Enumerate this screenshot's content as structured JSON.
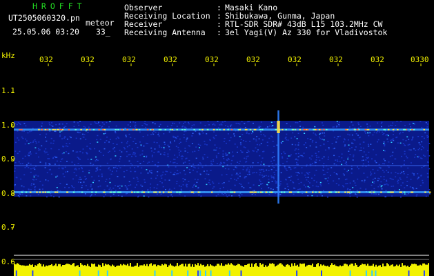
{
  "header": {
    "app_name": "HROFFT",
    "filename": "UT2505060320.pn",
    "meteor_label": "meteor",
    "datetime": "25.05.06 03:20",
    "count": "33_",
    "fields": [
      {
        "label": "Observer",
        "sep": ":",
        "value": "Masaki Kano"
      },
      {
        "label": "Receiving Location",
        "sep": ":",
        "value": "Shibukawa, Gunma, Japan"
      },
      {
        "label": "Receiver",
        "sep": ":",
        "value": "RTL-SDR SDR# 43dB L15 103.2MHz CW"
      },
      {
        "label": "Receiving Antenna",
        "sep": ":",
        "value": "3el Yagi(V) Az 330 for Vladivostok"
      }
    ]
  },
  "axis": {
    "y_unit": "kHz",
    "y_ticks": [
      "1.1",
      "1.0",
      "0.9",
      "0.8",
      "0.7",
      "0.6"
    ],
    "x_ticks": [
      "032",
      "032",
      "032",
      "032",
      "032",
      "032",
      "032",
      "032",
      "032",
      "0330"
    ]
  },
  "chart_data": {
    "type": "heatmap",
    "title": "",
    "xlabel": "",
    "ylabel": "kHz",
    "ylim": [
      0.6,
      1.15
    ],
    "x_ticks": [
      "032",
      "032",
      "032",
      "032",
      "032",
      "032",
      "032",
      "032",
      "032",
      "0330"
    ],
    "y_ticks": [
      1.1,
      1.0,
      0.9,
      0.8,
      0.7,
      0.6
    ],
    "band_khz": [
      0.8,
      1.0
    ],
    "carrier_lines_khz": [
      0.99,
      0.805
    ],
    "vertical_echo_x_fraction": 0.64
  },
  "colors": {
    "background": "#000000",
    "header_green": "#22dd22",
    "header_white": "#ffffff",
    "axis_yellow": "#f2f200",
    "noise_blue": "#1a2ecc",
    "signal_cyan": "#40d0ff"
  }
}
